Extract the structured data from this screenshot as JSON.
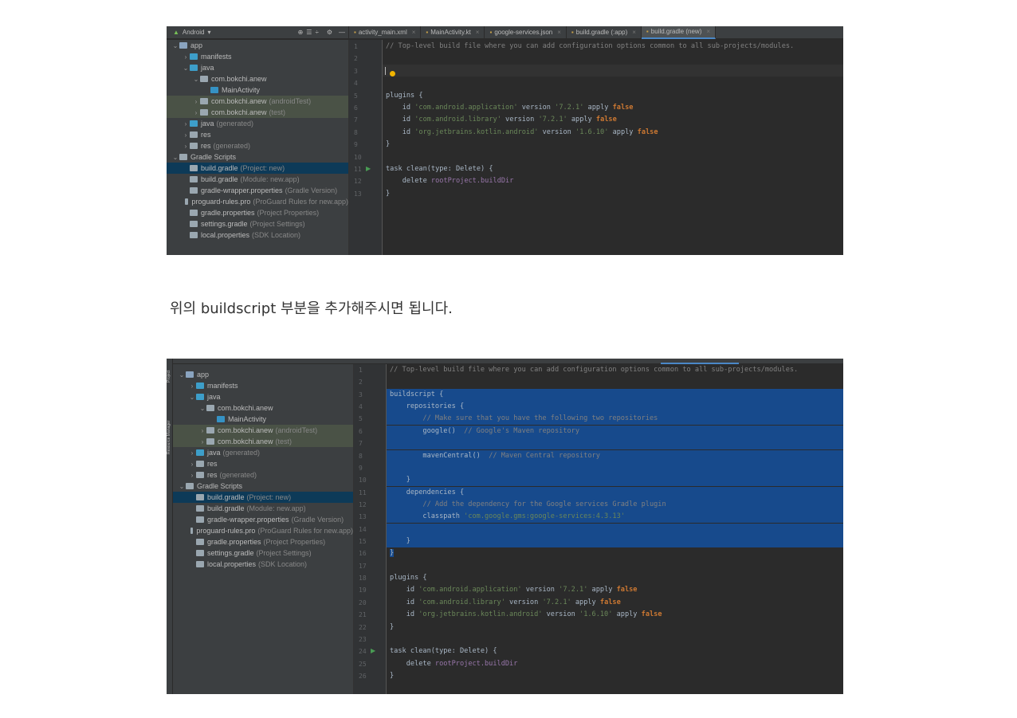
{
  "shot1": {
    "project_view": "Android",
    "tabs": [
      {
        "label": "activity_main.xml",
        "icon": "xml-layout-icon"
      },
      {
        "label": "MainActivity.kt",
        "icon": "kotlin-class-icon"
      },
      {
        "label": "google-services.json",
        "icon": "json-file-icon"
      },
      {
        "label": "build.gradle (:app)",
        "icon": "gradle-icon"
      },
      {
        "label": "build.gradle (new)",
        "icon": "gradle-icon",
        "active": true
      }
    ],
    "code": [
      [
        [
          "cm",
          "// Top-level build file where you can add configuration options common to all sub-projects/modules."
        ]
      ],
      [],
      [],
      [],
      [
        [
          "pl",
          "plugins {"
        ]
      ],
      [
        [
          "pl",
          "    id "
        ],
        [
          "str",
          "'com.android.application'"
        ],
        [
          "pl",
          " version "
        ],
        [
          "str",
          "'7.2.1'"
        ],
        [
          "pl",
          " apply "
        ],
        [
          "kw",
          "false"
        ]
      ],
      [
        [
          "pl",
          "    id "
        ],
        [
          "str",
          "'com.android.library'"
        ],
        [
          "pl",
          " version "
        ],
        [
          "str",
          "'7.2.1'"
        ],
        [
          "pl",
          " apply "
        ],
        [
          "kw",
          "false"
        ]
      ],
      [
        [
          "pl",
          "    id "
        ],
        [
          "str",
          "'org.jetbrains.kotlin.android'"
        ],
        [
          "pl",
          " version "
        ],
        [
          "str",
          "'1.6.10'"
        ],
        [
          "pl",
          " apply "
        ],
        [
          "kw",
          "false"
        ]
      ],
      [
        [
          "pl",
          "}"
        ]
      ],
      [],
      [
        [
          "pl",
          "task clean(type: Delete) {"
        ]
      ],
      [
        [
          "pl",
          "    delete "
        ],
        [
          "prop",
          "rootProject.buildDir"
        ]
      ],
      [
        [
          "pl",
          "}"
        ]
      ]
    ]
  },
  "caption": "위의 buildscript 부분을 추가해주시면 됩니다.",
  "tree": [
    {
      "label": "app",
      "depth": 0,
      "arrow": "⌄",
      "icon": "module-folder-icon",
      "color": "#8aa4c0"
    },
    {
      "label": "manifests",
      "depth": 1,
      "arrow": "›",
      "icon": "folder-icon",
      "color": "#3d9ec9"
    },
    {
      "label": "java",
      "depth": 1,
      "arrow": "⌄",
      "icon": "folder-icon",
      "color": "#3d9ec9"
    },
    {
      "label": "com.bokchi.anew",
      "depth": 2,
      "arrow": "⌄",
      "icon": "package-icon",
      "color": "#9aa7b0"
    },
    {
      "label": "MainActivity",
      "depth": 3,
      "arrow": "",
      "icon": "kotlin-class-icon",
      "color": "#3592c4"
    },
    {
      "label": "com.bokchi.anew",
      "suffix": "(androidTest)",
      "depth": 2,
      "arrow": "›",
      "icon": "package-icon",
      "color": "#9aa7b0",
      "hl": true
    },
    {
      "label": "com.bokchi.anew",
      "suffix": "(test)",
      "depth": 2,
      "arrow": "›",
      "icon": "package-icon",
      "color": "#9aa7b0",
      "hl": true
    },
    {
      "label": "java",
      "suffix": "(generated)",
      "depth": 1,
      "arrow": "›",
      "icon": "generated-folder-icon",
      "color": "#3d9ec9"
    },
    {
      "label": "res",
      "depth": 1,
      "arrow": "›",
      "icon": "res-folder-icon",
      "color": "#9aa7b0"
    },
    {
      "label": "res",
      "suffix": "(generated)",
      "depth": 1,
      "arrow": "›",
      "icon": "res-folder-icon",
      "color": "#9aa7b0"
    },
    {
      "label": "Gradle Scripts",
      "depth": 0,
      "arrow": "⌄",
      "icon": "gradle-icon",
      "color": "#9aa7b0"
    },
    {
      "label": "build.gradle",
      "suffix": "(Project: new)",
      "depth": 1,
      "arrow": "",
      "icon": "gradle-icon",
      "color": "#9aa7b0",
      "sel": true
    },
    {
      "label": "build.gradle",
      "suffix": "(Module: new.app)",
      "depth": 1,
      "arrow": "",
      "icon": "gradle-icon",
      "color": "#9aa7b0"
    },
    {
      "label": "gradle-wrapper.properties",
      "suffix": "(Gradle Version)",
      "depth": 1,
      "arrow": "",
      "icon": "properties-file-icon",
      "color": "#9aa7b0"
    },
    {
      "label": "proguard-rules.pro",
      "suffix": "(ProGuard Rules for new.app)",
      "depth": 1,
      "arrow": "",
      "icon": "text-file-icon",
      "color": "#9aa7b0"
    },
    {
      "label": "gradle.properties",
      "suffix": "(Project Properties)",
      "depth": 1,
      "arrow": "",
      "icon": "properties-file-icon",
      "color": "#9aa7b0"
    },
    {
      "label": "settings.gradle",
      "suffix": "(Project Settings)",
      "depth": 1,
      "arrow": "",
      "icon": "gradle-icon",
      "color": "#9aa7b0"
    },
    {
      "label": "local.properties",
      "suffix": "(SDK Location)",
      "depth": 1,
      "arrow": "",
      "icon": "properties-file-icon",
      "color": "#9aa7b0"
    }
  ],
  "shot2": {
    "side_tabs": [
      "Project",
      "Resource Manager"
    ],
    "selected_lines": [
      3,
      15
    ],
    "code": [
      [
        [
          "cm",
          "// Top-level build file where you can add configuration options common to all sub-projects/modules."
        ]
      ],
      [],
      [
        [
          "pl",
          "buildscript {"
        ]
      ],
      [
        [
          "pl",
          "    repositories {"
        ]
      ],
      [
        [
          "cm",
          "        // Make sure that you have the following two repositories"
        ]
      ],
      [
        [
          "pl",
          "        google()  "
        ],
        [
          "cm",
          "// Google's Maven repository"
        ]
      ],
      [],
      [
        [
          "pl",
          "        mavenCentral()  "
        ],
        [
          "cm",
          "// Maven Central repository"
        ]
      ],
      [],
      [
        [
          "pl",
          "    }"
        ]
      ],
      [
        [
          "pl",
          "    dependencies {"
        ]
      ],
      [
        [
          "cm",
          "        // Add the dependency for the Google services Gradle plugin"
        ]
      ],
      [
        [
          "pl",
          "        classpath "
        ],
        [
          "str",
          "'com.google.gms:google-services:4.3.13'"
        ]
      ],
      [],
      [
        [
          "pl",
          "    }"
        ]
      ],
      [
        [
          "pl",
          "}"
        ]
      ],
      [],
      [
        [
          "pl",
          "plugins {"
        ]
      ],
      [
        [
          "pl",
          "    id "
        ],
        [
          "str",
          "'com.android.application'"
        ],
        [
          "pl",
          " version "
        ],
        [
          "str",
          "'7.2.1'"
        ],
        [
          "pl",
          " apply "
        ],
        [
          "kw",
          "false"
        ]
      ],
      [
        [
          "pl",
          "    id "
        ],
        [
          "str",
          "'com.android.library'"
        ],
        [
          "pl",
          " version "
        ],
        [
          "str",
          "'7.2.1'"
        ],
        [
          "pl",
          " apply "
        ],
        [
          "kw",
          "false"
        ]
      ],
      [
        [
          "pl",
          "    id "
        ],
        [
          "str",
          "'org.jetbrains.kotlin.android'"
        ],
        [
          "pl",
          " version "
        ],
        [
          "str",
          "'1.6.10'"
        ],
        [
          "pl",
          " apply "
        ],
        [
          "kw",
          "false"
        ]
      ],
      [
        [
          "pl",
          "}"
        ]
      ],
      [],
      [
        [
          "pl",
          "task clean(type: Delete) {"
        ]
      ],
      [
        [
          "pl",
          "    delete "
        ],
        [
          "prop",
          "rootProject.buildDir"
        ]
      ],
      [
        [
          "pl",
          "}"
        ]
      ]
    ]
  }
}
